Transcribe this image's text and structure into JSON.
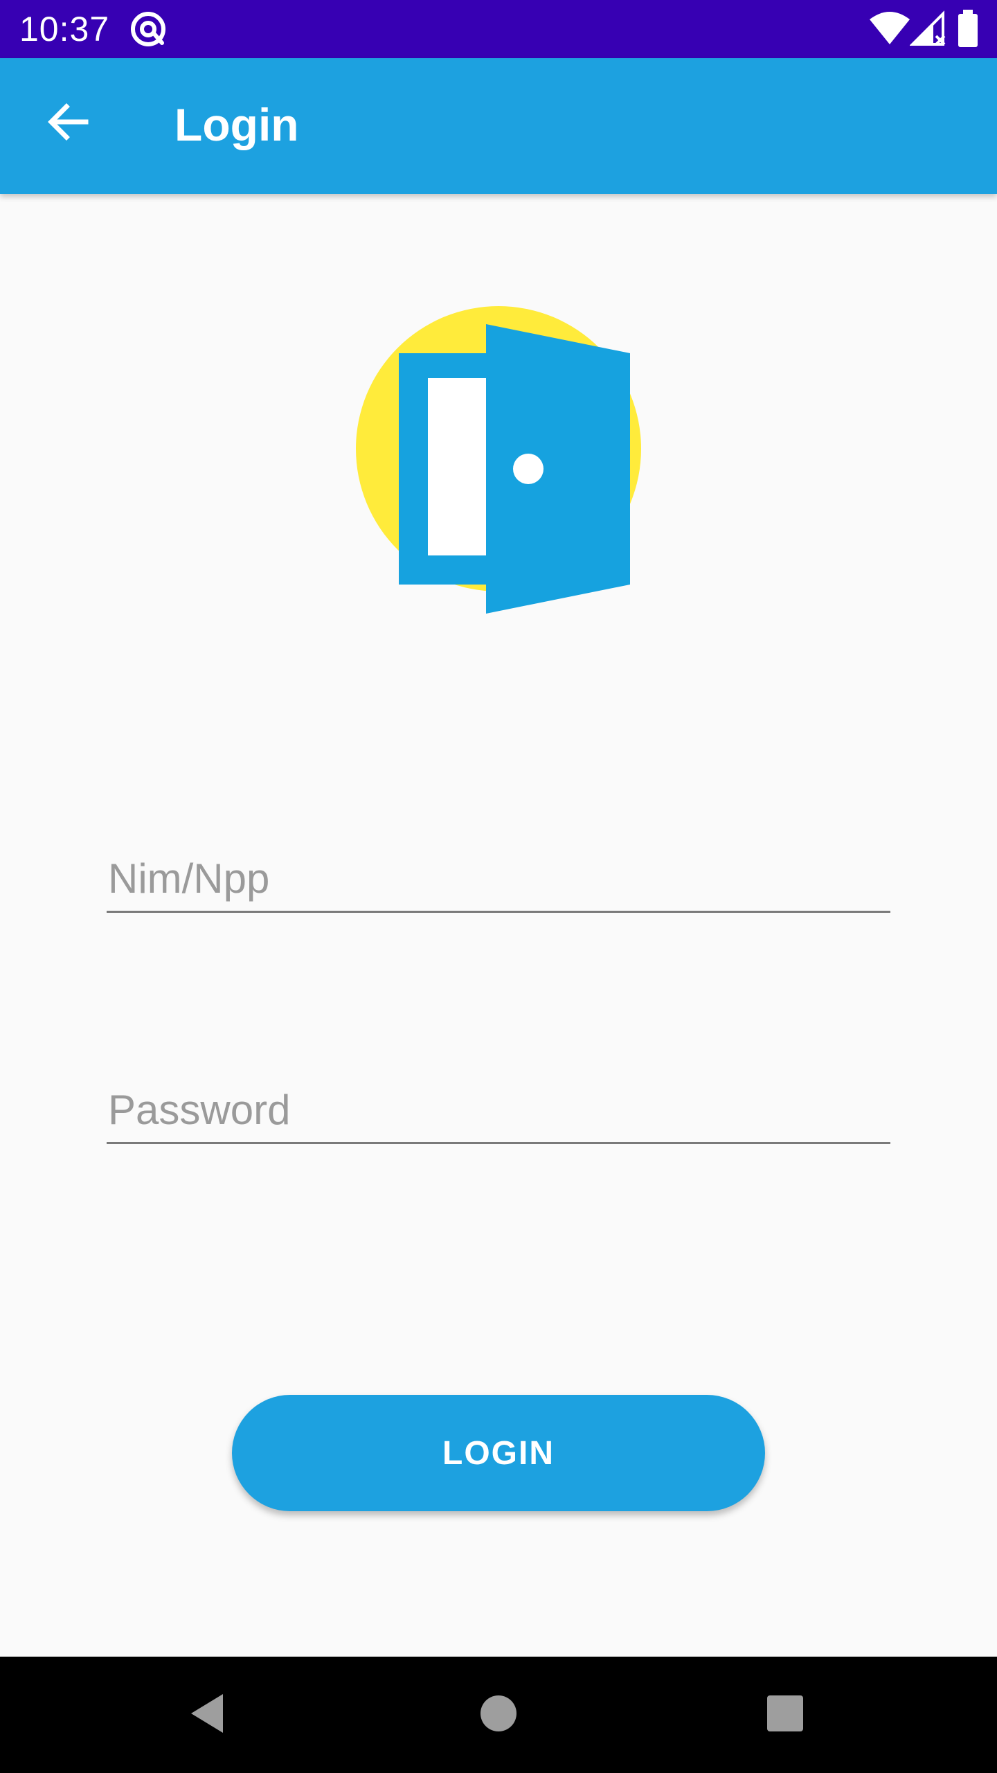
{
  "status_bar": {
    "time": "10:37",
    "icons": [
      "at-sign-icon",
      "wifi-icon",
      "signal-icon",
      "battery-icon"
    ]
  },
  "app_bar": {
    "title": "Login",
    "back_icon": "arrow-back-icon",
    "color": "#1da1e0"
  },
  "logo": {
    "icon": "open-door-icon",
    "circle_color": "#ffeb3b",
    "door_color": "#16a2df"
  },
  "form": {
    "nim_placeholder": "Nim/Npp",
    "nim_value": "",
    "password_placeholder": "Password",
    "password_value": ""
  },
  "login_button": {
    "label": "LOGIN",
    "color": "#1da1e0"
  },
  "nav_bar": {
    "items": [
      "back-triangle-icon",
      "home-circle-icon",
      "recents-square-icon"
    ]
  }
}
